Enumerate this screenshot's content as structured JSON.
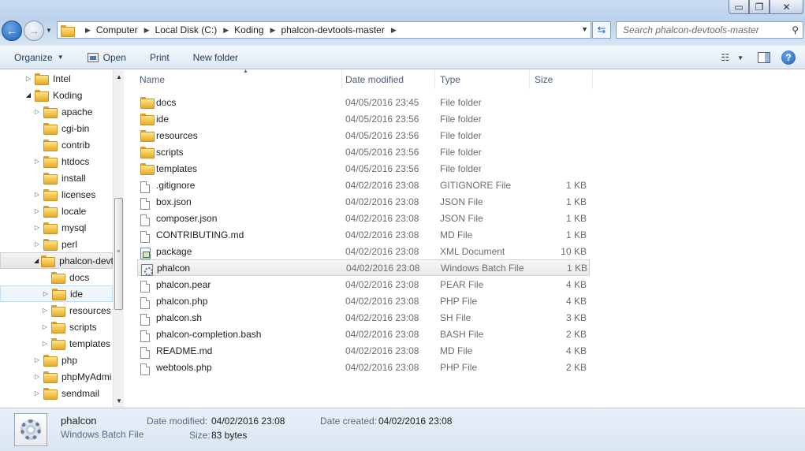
{
  "window": {
    "min_glyph": "▭",
    "max_glyph": "❐",
    "close_glyph": "✕"
  },
  "address": {
    "crumbs": [
      "Computer",
      "Local Disk (C:)",
      "Koding",
      "phalcon-devtools-master"
    ],
    "search_placeholder": "Search phalcon-devtools-master"
  },
  "toolbar": {
    "organize": "Organize",
    "open": "Open",
    "print": "Print",
    "new_folder": "New folder"
  },
  "tree": {
    "items": [
      {
        "label": "Intel",
        "indent": 0,
        "twisty": "▷"
      },
      {
        "label": "Koding",
        "indent": 0,
        "twisty": "◢"
      },
      {
        "label": "apache",
        "indent": 1,
        "twisty": "▷"
      },
      {
        "label": "cgi-bin",
        "indent": 1,
        "twisty": ""
      },
      {
        "label": "contrib",
        "indent": 1,
        "twisty": ""
      },
      {
        "label": "htdocs",
        "indent": 1,
        "twisty": "▷"
      },
      {
        "label": "install",
        "indent": 1,
        "twisty": ""
      },
      {
        "label": "licenses",
        "indent": 1,
        "twisty": "▷"
      },
      {
        "label": "locale",
        "indent": 1,
        "twisty": "▷"
      },
      {
        "label": "mysql",
        "indent": 1,
        "twisty": "▷"
      },
      {
        "label": "perl",
        "indent": 1,
        "twisty": "▷"
      },
      {
        "label": "phalcon-devt",
        "indent": 1,
        "twisty": "◢"
      },
      {
        "label": "docs",
        "indent": 2,
        "twisty": ""
      },
      {
        "label": "ide",
        "indent": 2,
        "twisty": "▷"
      },
      {
        "label": "resources",
        "indent": 2,
        "twisty": "▷"
      },
      {
        "label": "scripts",
        "indent": 2,
        "twisty": "▷"
      },
      {
        "label": "templates",
        "indent": 2,
        "twisty": "▷"
      },
      {
        "label": "php",
        "indent": 1,
        "twisty": "▷"
      },
      {
        "label": "phpMyAdmi",
        "indent": 1,
        "twisty": "▷"
      },
      {
        "label": "sendmail",
        "indent": 1,
        "twisty": "▷"
      }
    ]
  },
  "columns": {
    "name": "Name",
    "date": "Date modified",
    "type": "Type",
    "size": "Size"
  },
  "files": [
    {
      "name": "docs",
      "date": "04/05/2016 23:45",
      "type": "File folder",
      "size": "",
      "icon": "folder-icon"
    },
    {
      "name": "ide",
      "date": "04/05/2016 23:56",
      "type": "File folder",
      "size": "",
      "icon": "folder-icon"
    },
    {
      "name": "resources",
      "date": "04/05/2016 23:56",
      "type": "File folder",
      "size": "",
      "icon": "folder-icon"
    },
    {
      "name": "scripts",
      "date": "04/05/2016 23:56",
      "type": "File folder",
      "size": "",
      "icon": "folder-icon"
    },
    {
      "name": "templates",
      "date": "04/05/2016 23:56",
      "type": "File folder",
      "size": "",
      "icon": "folder-icon"
    },
    {
      "name": ".gitignore",
      "date": "04/02/2016 23:08",
      "type": "GITIGNORE File",
      "size": "1 KB",
      "icon": "file-icon"
    },
    {
      "name": "box.json",
      "date": "04/02/2016 23:08",
      "type": "JSON File",
      "size": "1 KB",
      "icon": "file-icon"
    },
    {
      "name": "composer.json",
      "date": "04/02/2016 23:08",
      "type": "JSON File",
      "size": "1 KB",
      "icon": "file-icon"
    },
    {
      "name": "CONTRIBUTING.md",
      "date": "04/02/2016 23:08",
      "type": "MD File",
      "size": "1 KB",
      "icon": "file-icon"
    },
    {
      "name": "package",
      "date": "04/02/2016 23:08",
      "type": "XML Document",
      "size": "10 KB",
      "icon": "xml-file-icon"
    },
    {
      "name": "phalcon",
      "date": "04/02/2016 23:08",
      "type": "Windows Batch File",
      "size": "1 KB",
      "icon": "batch-file-icon"
    },
    {
      "name": "phalcon.pear",
      "date": "04/02/2016 23:08",
      "type": "PEAR File",
      "size": "4 KB",
      "icon": "file-icon"
    },
    {
      "name": "phalcon.php",
      "date": "04/02/2016 23:08",
      "type": "PHP File",
      "size": "4 KB",
      "icon": "file-icon"
    },
    {
      "name": "phalcon.sh",
      "date": "04/02/2016 23:08",
      "type": "SH File",
      "size": "3 KB",
      "icon": "file-icon"
    },
    {
      "name": "phalcon-completion.bash",
      "date": "04/02/2016 23:08",
      "type": "BASH File",
      "size": "2 KB",
      "icon": "file-icon"
    },
    {
      "name": "README.md",
      "date": "04/02/2016 23:08",
      "type": "MD File",
      "size": "4 KB",
      "icon": "file-icon"
    },
    {
      "name": "webtools.php",
      "date": "04/02/2016 23:08",
      "type": "PHP File",
      "size": "2 KB",
      "icon": "file-icon"
    }
  ],
  "details": {
    "name": "phalcon",
    "type": "Windows Batch File",
    "modified_label": "Date modified:",
    "modified_value": "04/02/2016 23:08",
    "created_label": "Date created:",
    "created_value": "04/02/2016 23:08",
    "size_label": "Size:",
    "size_value": "83 bytes"
  }
}
